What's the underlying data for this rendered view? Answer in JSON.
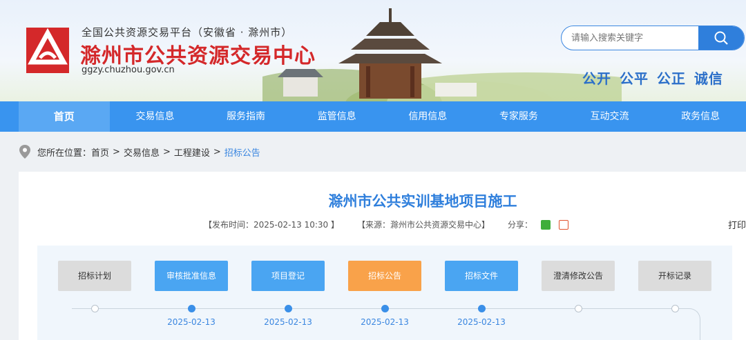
{
  "header": {
    "platform_name": "全国公共资源交易平台（安徽省 · 滁州市）",
    "site_title": "滁州市公共资源交易中心",
    "site_url": "ggzy.chuzhou.gov.cn",
    "search_placeholder": "请输入搜索关键字",
    "slogan": "公开 公平 公正 诚信",
    "brand_color": "#d4282a"
  },
  "nav": {
    "items": [
      "首页",
      "交易信息",
      "服务指南",
      "监管信息",
      "信用信息",
      "专家服务",
      "互动交流",
      "政务信息"
    ],
    "active": "首页"
  },
  "breadcrumb": {
    "prefix": "您所在位置：",
    "items": [
      "首页",
      "交易信息",
      "工程建设",
      "招标公告"
    ],
    "separator": ">"
  },
  "article": {
    "title": "滁州市公共实训基地项目施工",
    "publish_time": "【发布时间：2025-02-13 10:30 】",
    "source": "【来源：滁州市公共资源交易中心】",
    "share_label": "分享：",
    "print_label": "打印"
  },
  "flow": {
    "steps": [
      {
        "label": "招标计划",
        "state": "gray"
      },
      {
        "label": "审核批准信息",
        "state": "blue"
      },
      {
        "label": "项目登记",
        "state": "blue"
      },
      {
        "label": "招标公告",
        "state": "orange"
      },
      {
        "label": "招标文件",
        "state": "blue"
      },
      {
        "label": "澄清修改公告",
        "state": "gray"
      },
      {
        "label": "开标记录",
        "state": "gray"
      }
    ],
    "dates": [
      "",
      "2025-02-13",
      "2025-02-13",
      "2025-02-13",
      "2025-02-13",
      "",
      ""
    ]
  }
}
